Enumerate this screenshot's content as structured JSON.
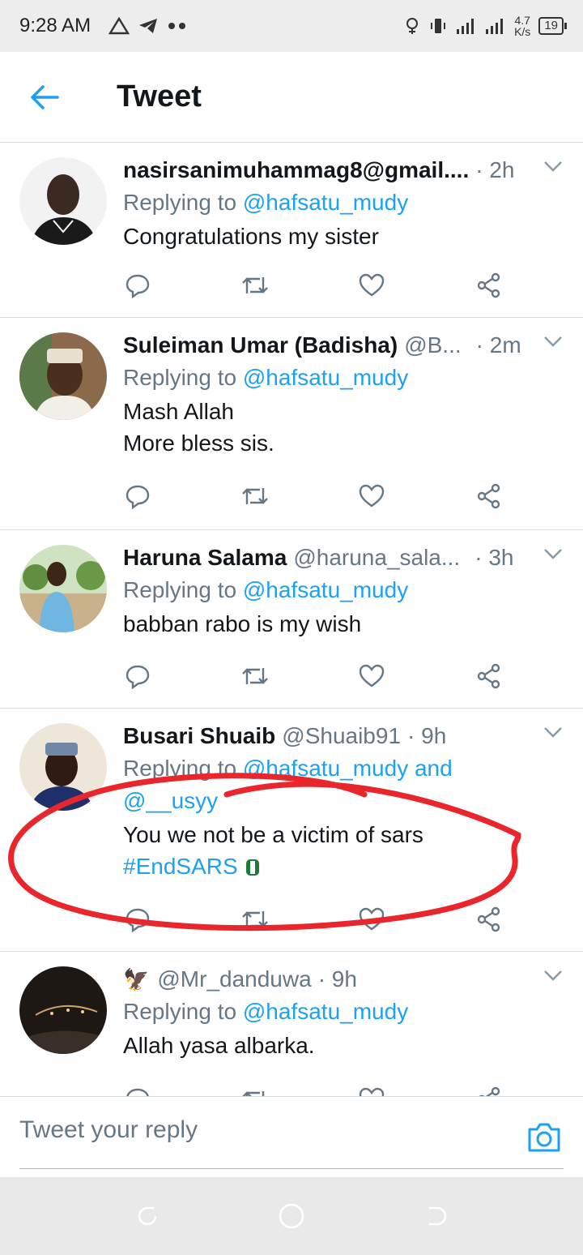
{
  "status_bar": {
    "time": "9:28 AM",
    "net_speed_top": "4.7",
    "net_speed_bottom": "K/s",
    "battery": "19",
    "icons": [
      "alert-triangle-icon",
      "telegram-icon",
      "dots-icon",
      "alarm-icon",
      "vibrate-icon",
      "signal-icon",
      "signal-icon",
      "battery-icon"
    ]
  },
  "header": {
    "title": "Tweet",
    "back_icon": "arrow-left-icon",
    "accent": "#1da1f2"
  },
  "tweets": [
    {
      "name": "nasirsanimuhammag8@gmail....",
      "handle": "",
      "time": "· 2h",
      "reply_prefix": "Replying to",
      "reply_mention": "@hafsatu_mudy",
      "text_lines": [
        "Congratulations my sister"
      ]
    },
    {
      "name": "Suleiman Umar (Badisha)",
      "handle": "@B...",
      "time": "· 2m",
      "reply_prefix": "Replying to",
      "reply_mention": "@hafsatu_mudy",
      "text_lines": [
        "Mash Allah",
        "More bless sis."
      ]
    },
    {
      "name": "Haruna Salama",
      "handle": "@haruna_sala...",
      "time": "· 3h",
      "reply_prefix": "Replying to",
      "reply_mention": "@hafsatu_mudy",
      "text_lines": [
        "babban rabo is my wish"
      ]
    },
    {
      "name": "Busari Shuaib",
      "handle": "@Shuaib91",
      "time": "· 9h",
      "reply_prefix": "Replying to",
      "reply_mention": "@hafsatu_mudy and",
      "reply_mention_2": "@__usyy",
      "text_lines": [
        "You we not be a victim of sars"
      ],
      "hashtag": "#EndSARS"
    },
    {
      "name": "🦅",
      "handle": "@Mr_danduwa",
      "time": "· 9h",
      "reply_prefix": "Replying to",
      "reply_mention": "@hafsatu_mudy",
      "text_lines": [
        "Allah yasa albarka."
      ]
    }
  ],
  "actions": [
    "reply-icon",
    "retweet-icon",
    "like-icon",
    "share-icon"
  ],
  "reply_bar": {
    "placeholder": "Tweet your reply",
    "camera_icon": "camera-icon"
  },
  "annotation_color": "#e8262b"
}
